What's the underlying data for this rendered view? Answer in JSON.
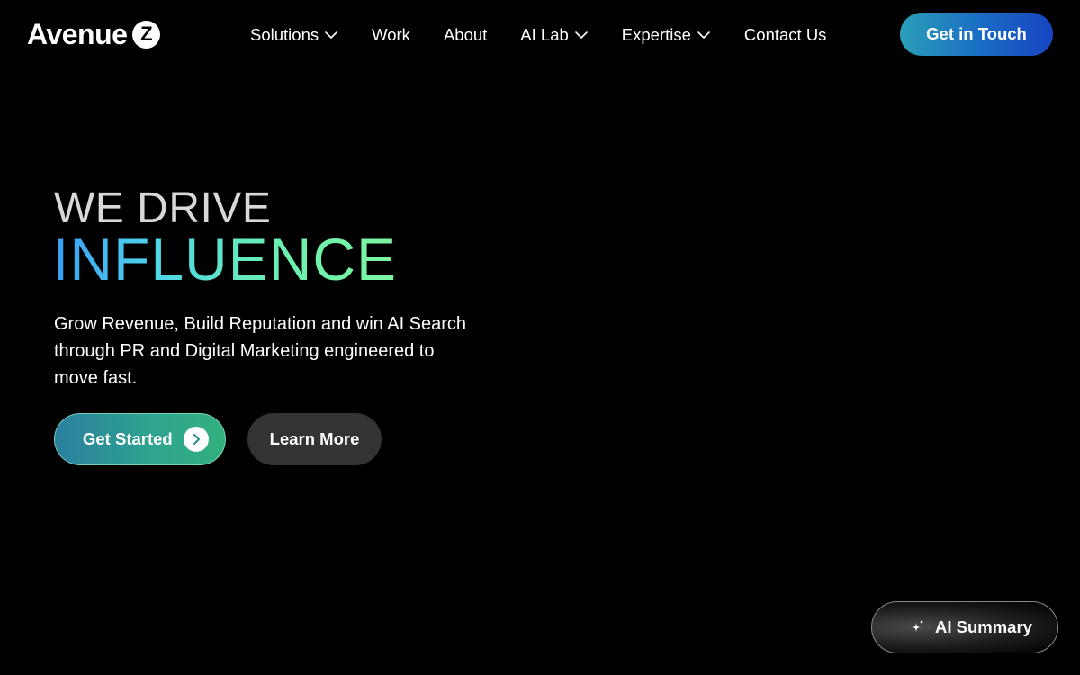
{
  "brand": {
    "name": "Avenue",
    "badge_letter": "Z"
  },
  "nav": {
    "items": [
      {
        "label": "Solutions",
        "has_dropdown": true
      },
      {
        "label": "Work",
        "has_dropdown": false
      },
      {
        "label": "About",
        "has_dropdown": false
      },
      {
        "label": "AI Lab",
        "has_dropdown": true
      },
      {
        "label": "Expertise",
        "has_dropdown": true
      },
      {
        "label": "Contact Us",
        "has_dropdown": false
      }
    ],
    "cta_label": "Get in Touch"
  },
  "hero": {
    "line1": "WE DRIVE",
    "line2": "INFLUENCE",
    "subtitle": "Grow Revenue, Build Reputation and win AI Search through PR and Digital Marketing engineered to move fast.",
    "primary_button": "Get Started",
    "secondary_button": "Learn More"
  },
  "floating": {
    "ai_summary_label": "AI Summary"
  },
  "colors": {
    "background": "#000000",
    "accent_blue": "#1a6ac4",
    "accent_teal": "#2fa58e",
    "gradient_text_start": "#3a9cf5",
    "gradient_text_end": "#7cf5a0",
    "secondary_button": "#333333"
  },
  "icons": {
    "dropdown": "chevron-down-icon",
    "get_started": "chevron-right-circle-icon",
    "ai_summary": "sparkle-icon"
  }
}
